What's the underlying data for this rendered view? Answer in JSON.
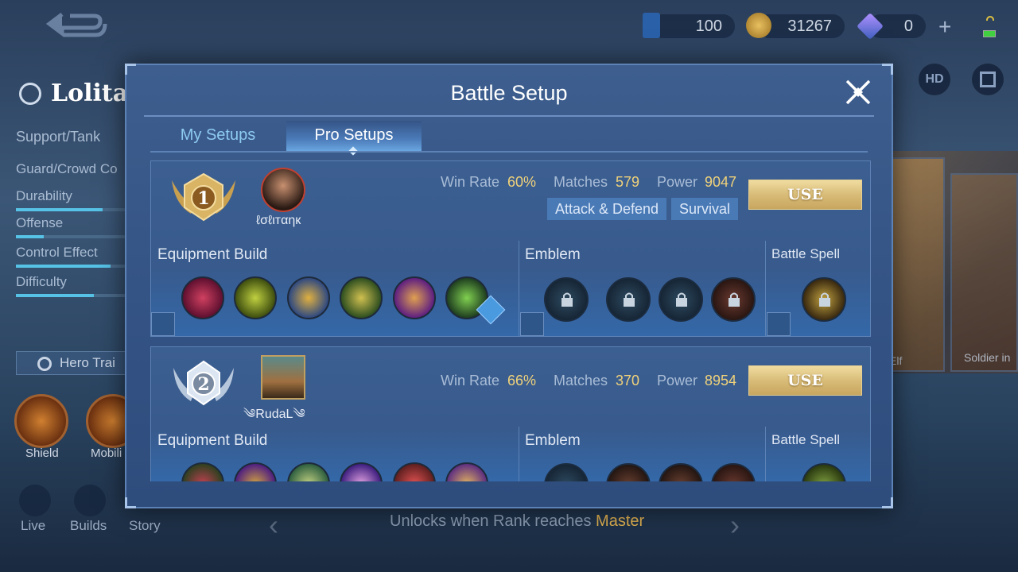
{
  "topbar": {
    "ticket_value": "100",
    "gold_value": "31267",
    "diamond_value": "0",
    "hd_label": "HD"
  },
  "hero": {
    "name": "Lolita",
    "role": "Support/Tank",
    "specialty": "Guard/Crowd Co",
    "stats": [
      {
        "label": "Durability",
        "level": 0.78
      },
      {
        "label": "Offense",
        "level": 0.25
      },
      {
        "label": "Control Effect",
        "level": 0.85
      },
      {
        "label": "Difficulty",
        "level": 0.7
      }
    ],
    "hero_training": "Hero Trai",
    "skills": [
      "Shield",
      "Mobili"
    ]
  },
  "bottom_nav": [
    "Live",
    "Builds",
    "Story"
  ],
  "unlock": {
    "text": "Unlocks when Rank reaches",
    "rank": "Master"
  },
  "bg_cards": [
    "Elf",
    "Soldier in"
  ],
  "modal": {
    "title": "Battle Setup",
    "tabs": [
      "My Setups",
      "Pro Setups"
    ],
    "active_tab": "Pro Setups",
    "sections": {
      "equipment": "Equipment Build",
      "emblem": "Emblem",
      "spell": "Battle Spell"
    },
    "setups": [
      {
        "rank": "1",
        "player": "ℓσℓιтαηк",
        "win_rate_label": "Win Rate",
        "win_rate": "60%",
        "matches_label": "Matches",
        "matches": "579",
        "power_label": "Power",
        "power": "9047",
        "tags": [
          "Attack & Defend",
          "Survival"
        ],
        "use_label": "USE"
      },
      {
        "rank": "2",
        "player": "༄RudaL༄",
        "win_rate_label": "Win Rate",
        "win_rate": "66%",
        "matches_label": "Matches",
        "matches": "370",
        "power_label": "Power",
        "power": "8954",
        "tags": [],
        "use_label": "USE"
      }
    ]
  },
  "colors": {
    "accent_value": "#f0d27a",
    "use_button": "#d8bc78",
    "tab_active": "#6aa6e0"
  }
}
